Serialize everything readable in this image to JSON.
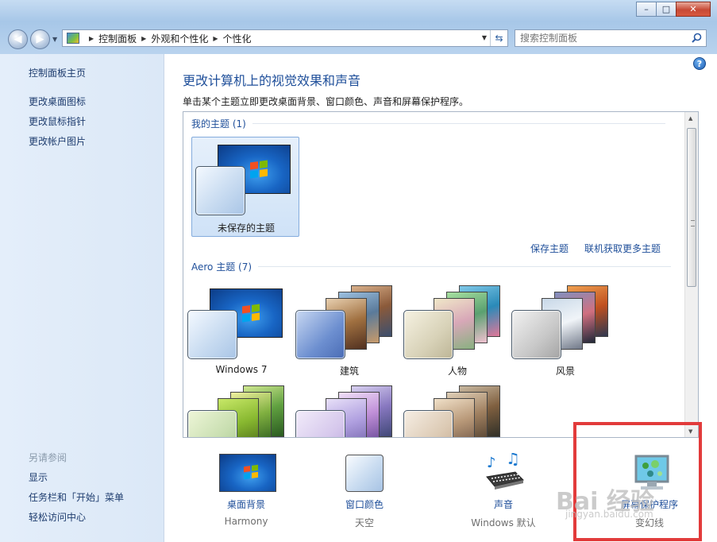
{
  "window": {
    "minimize": "–",
    "maximize": "□",
    "close": "✕"
  },
  "address": {
    "crumbs": [
      "控制面板",
      "外观和个性化",
      "个性化"
    ]
  },
  "search": {
    "placeholder": "搜索控制面板"
  },
  "sidebar": {
    "home": "控制面板主页",
    "links": [
      "更改桌面图标",
      "更改鼠标指针",
      "更改帐户图片"
    ],
    "see_also_title": "另请参阅",
    "see_also": [
      "显示",
      "任务栏和「开始」菜单",
      "轻松访问中心"
    ]
  },
  "main": {
    "title": "更改计算机上的视觉效果和声音",
    "subtitle": "单击某个主题立即更改桌面背景、窗口颜色、声音和屏幕保护程序。",
    "my_themes_header": "我的主题 (1)",
    "unsaved_theme": "未保存的主题",
    "save_theme": "保存主题",
    "get_more": "联机获取更多主题",
    "aero_header": "Aero 主题 (7)",
    "aero_themes": [
      "Windows 7",
      "建筑",
      "人物",
      "风景"
    ]
  },
  "bottom": {
    "desktop_bg": {
      "label": "桌面背景",
      "value": "Harmony"
    },
    "window_color": {
      "label": "窗口颜色",
      "value": "天空"
    },
    "sounds": {
      "label": "声音",
      "value": "Windows 默认"
    },
    "screensaver": {
      "label": "屏幕保护程序",
      "value": "变幻线"
    }
  },
  "watermark": {
    "brand": "Bai 经验",
    "url": "jingyan.baidu.com"
  },
  "colors": {
    "link": "#1f4f9a",
    "highlight": "#e23b3b"
  }
}
